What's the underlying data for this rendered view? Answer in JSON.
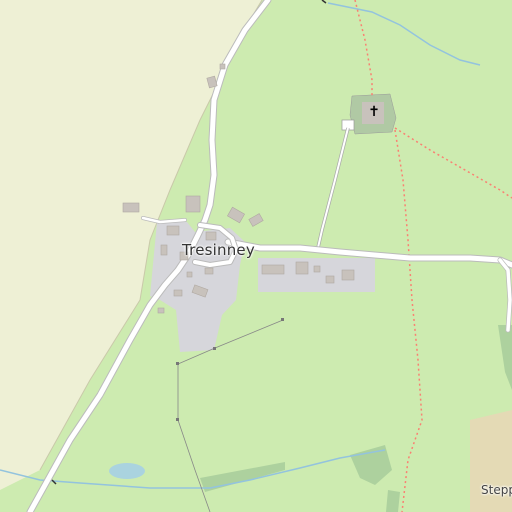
{
  "map": {
    "place_name": "Tresinney",
    "edge_label": "Stepp",
    "icons": {
      "church": "church-cross-icon"
    },
    "colors": {
      "grass": "#cdebb0",
      "farmland": "#eef0d5",
      "residential": "#d9d0c9",
      "residential_gray": "#d6d6db",
      "building": "#c8c2bc",
      "road": "#ffffff",
      "road_casing": "#bbbbbb",
      "water": "#aad3df",
      "stream": "#93c3de",
      "wood": "#add19e",
      "path": "#fa8072",
      "track": "#b29a55"
    }
  }
}
